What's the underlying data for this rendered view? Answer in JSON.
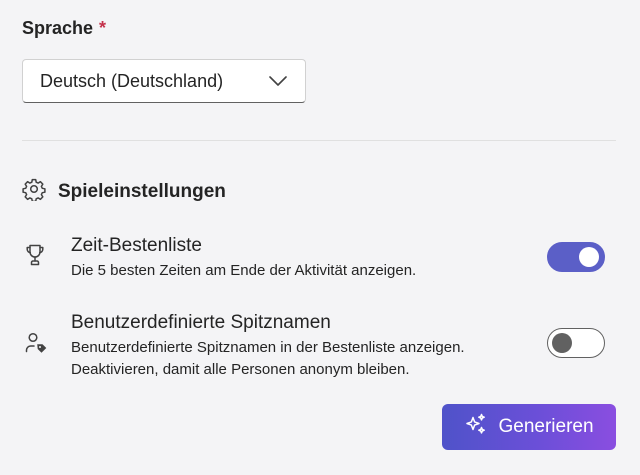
{
  "language": {
    "label": "Sprache",
    "required_mark": "*",
    "selected_value": "Deutsch (Deutschland)"
  },
  "game_settings": {
    "title": "Spieleinstellungen",
    "settings": [
      {
        "title": "Zeit-Bestenliste",
        "description": "Die 5 besten Zeiten am Ende der Aktivität anzeigen.",
        "enabled": true,
        "icon": "trophy-icon"
      },
      {
        "title": "Benutzerdefinierte Spitznamen",
        "description_lines": [
          "Benutzerdefinierte Spitznamen in der Bestenliste anzeigen.",
          "Deaktivieren, damit alle Personen anonym bleiben."
        ],
        "enabled": false,
        "icon": "user-tag-icon"
      }
    ]
  },
  "generate_button": {
    "label": "Generieren",
    "icon": "sparkle-icon"
  },
  "colors": {
    "accent": "#5b5fc7",
    "required": "#c4314b",
    "background": "#f4f4f6"
  }
}
